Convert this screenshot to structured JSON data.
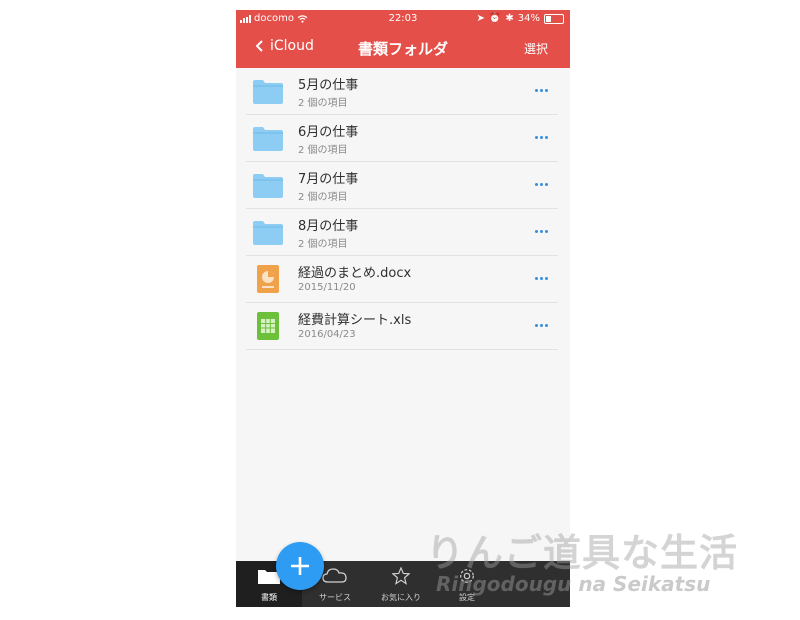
{
  "status": {
    "carrier": "docomo",
    "time": "22:03",
    "battery": "34%"
  },
  "nav": {
    "back_label": "iCloud",
    "title": "書類フォルダ",
    "select_label": "選択"
  },
  "items": [
    {
      "name": "5月の仕事",
      "sub": "2 個の項目",
      "type": "folder"
    },
    {
      "name": "6月の仕事",
      "sub": "2 個の項目",
      "type": "folder"
    },
    {
      "name": "7月の仕事",
      "sub": "2 個の項目",
      "type": "folder"
    },
    {
      "name": "8月の仕事",
      "sub": "2 個の項目",
      "type": "folder"
    },
    {
      "name": "経過のまとめ.docx",
      "sub": "2015/11/20",
      "type": "presentation"
    },
    {
      "name": "経費計算シート.xls",
      "sub": "2016/04/23",
      "type": "spreadsheet"
    }
  ],
  "tabs": [
    {
      "label": "書類",
      "icon": "folder-icon"
    },
    {
      "label": "サービス",
      "icon": "cloud-icon"
    },
    {
      "label": "お気に入り",
      "icon": "star-icon"
    },
    {
      "label": "設定",
      "icon": "gear-icon"
    }
  ],
  "watermark": {
    "line1": "りんご道具な生活",
    "line2": "Ringodougu na Seikatsu"
  },
  "colors": {
    "header": "#e45049",
    "accent": "#3a8fdc",
    "fab": "#2e9cf2",
    "folder": "#8ecdf3"
  }
}
